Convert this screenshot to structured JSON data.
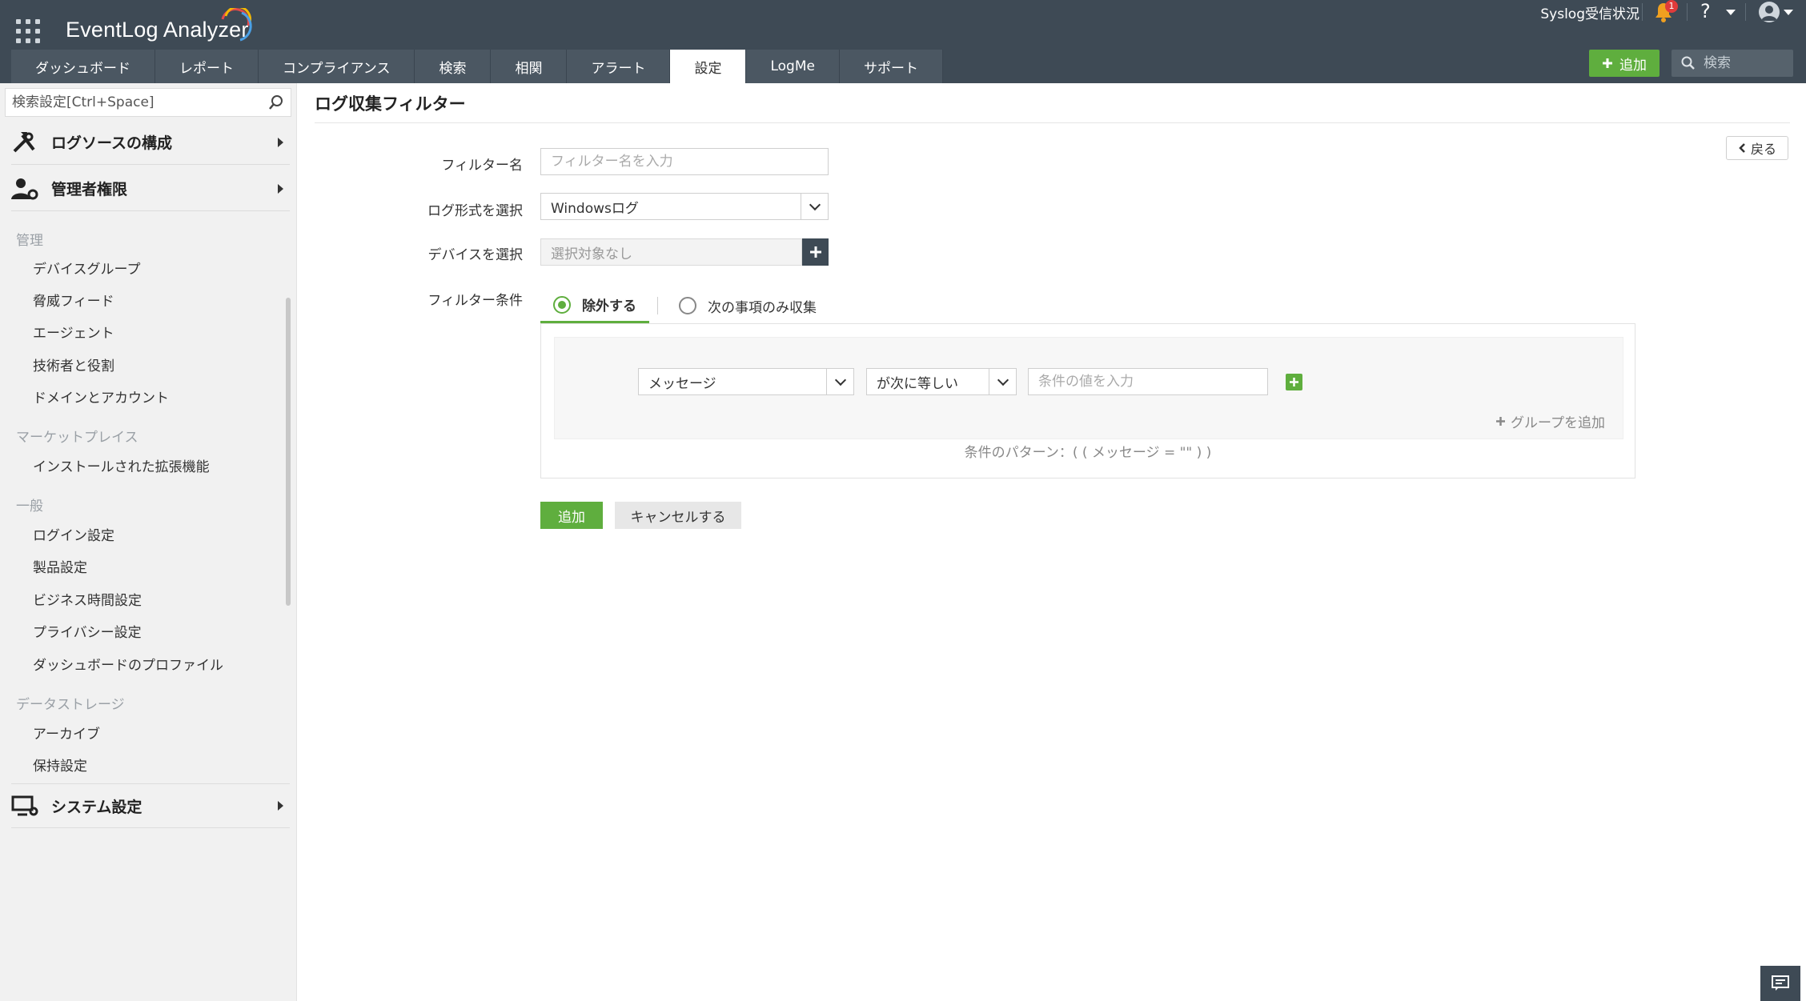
{
  "app": {
    "title": "EventLog Analyzer"
  },
  "header": {
    "syslog_status": "Syslog受信状況",
    "notification_count": "1",
    "help_label": "?",
    "add_label": "追加",
    "search_placeholder": "検索"
  },
  "tabs": [
    {
      "label": "ダッシュボード"
    },
    {
      "label": "レポート"
    },
    {
      "label": "コンプライアンス"
    },
    {
      "label": "検索"
    },
    {
      "label": "相関"
    },
    {
      "label": "アラート"
    },
    {
      "label": "設定",
      "active": true
    },
    {
      "label": "LogMe"
    },
    {
      "label": "サポート"
    }
  ],
  "sidebar": {
    "search_placeholder": "検索設定[Ctrl+Space]",
    "sections": [
      {
        "label": "ログソースの構成"
      },
      {
        "label": "管理者権限"
      },
      {
        "label": "システム設定"
      }
    ],
    "categories": [
      {
        "label": "管理",
        "items": [
          "デバイスグループ",
          "脅威フィード",
          "エージェント",
          "技術者と役割",
          "ドメインとアカウント"
        ]
      },
      {
        "label": "マーケットプレイス",
        "items": [
          "インストールされた拡張機能"
        ]
      },
      {
        "label": "一般",
        "items": [
          "ログイン設定",
          "製品設定",
          "ビジネス時間設定",
          "プライバシー設定",
          "ダッシュボードのプロファイル"
        ]
      },
      {
        "label": "データストレージ",
        "items": [
          "アーカイブ",
          "保持設定"
        ]
      }
    ]
  },
  "main": {
    "title": "ログ収集フィルター",
    "back_label": "戻る",
    "form": {
      "filter_name_label": "フィルター名",
      "filter_name_placeholder": "フィルター名を入力",
      "log_format_label": "ログ形式を選択",
      "log_format_value": "Windowsログ",
      "device_label": "デバイスを選択",
      "device_value": "選択対象なし",
      "condition_label": "フィルター条件",
      "radio_exclude": "除外する",
      "radio_include": "次の事項のみ収集",
      "field_select": "メッセージ",
      "operator_select": "が次に等しい",
      "value_placeholder": "条件の値を入力",
      "add_group": "グループを追加",
      "pattern": "条件のパターン：( ( メッセージ = \"\" ) )",
      "submit": "追加",
      "cancel": "キャンセルする"
    }
  },
  "colors": {
    "header_bg": "#3e4a55",
    "accent_green": "#5fae3e",
    "sidebar_bg": "#f1f1f1"
  }
}
